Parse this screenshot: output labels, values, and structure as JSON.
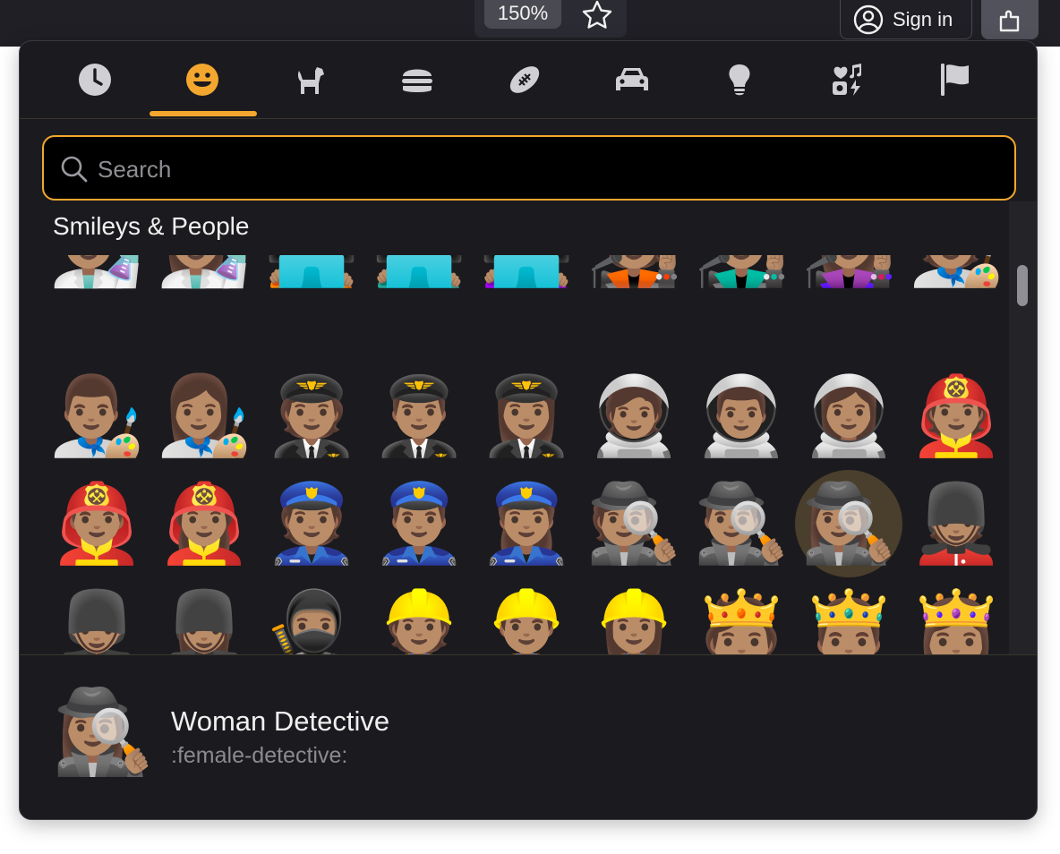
{
  "browser": {
    "zoom_label": "150%",
    "signin_label": "Sign in"
  },
  "tabs": [
    {
      "name": "recent",
      "icon": "clock-icon"
    },
    {
      "name": "smileys",
      "icon": "smiley-icon"
    },
    {
      "name": "animals",
      "icon": "dog-icon"
    },
    {
      "name": "food",
      "icon": "burger-icon"
    },
    {
      "name": "activities",
      "icon": "football-icon"
    },
    {
      "name": "travel",
      "icon": "car-icon"
    },
    {
      "name": "objects",
      "icon": "lightbulb-icon"
    },
    {
      "name": "symbols",
      "icon": "symbols-icon"
    },
    {
      "name": "flags",
      "icon": "flag-icon"
    }
  ],
  "colors": {
    "accent": "#f4a72e",
    "icon": "#cfcfd4",
    "panel": "#1b1b1f"
  },
  "search": {
    "placeholder": "Search"
  },
  "section": {
    "title": "Smileys & People"
  },
  "emoji_rows": [
    [
      "👨🏽‍🔬",
      "👩🏽‍🔬",
      "🧑🏽‍💻",
      "👨🏽‍💻",
      "👩🏽‍💻",
      "🧑🏽‍🎤",
      "👨🏽‍🎤",
      "👩🏽‍🎤",
      "🧑🏽‍🎨"
    ],
    [
      "👨🏽‍🎨",
      "👩🏽‍🎨",
      "🧑🏽‍✈️",
      "👨🏽‍✈️",
      "👩🏽‍✈️",
      "🧑🏽‍🚀",
      "👨🏽‍🚀",
      "👩🏽‍🚀",
      "🧑🏽‍🚒"
    ],
    [
      "👨🏽‍🚒",
      "👩🏽‍🚒",
      "👮🏽",
      "👮🏽‍♂️",
      "👮🏽‍♀️",
      "🕵🏽",
      "🕵🏽‍♂️",
      "🕵🏽‍♀️",
      "💂🏽"
    ],
    [
      "💂🏽‍♂️",
      "💂🏽‍♀️",
      "🥷🏽",
      "👷🏽",
      "👷🏽‍♂️",
      "👷🏽‍♀️",
      "🫅🏽",
      "🤴🏽",
      "👸🏽"
    ]
  ],
  "preview": {
    "emoji": "🕵🏽‍♀️",
    "name": "Woman Detective",
    "shortcode": ":female-detective:"
  }
}
